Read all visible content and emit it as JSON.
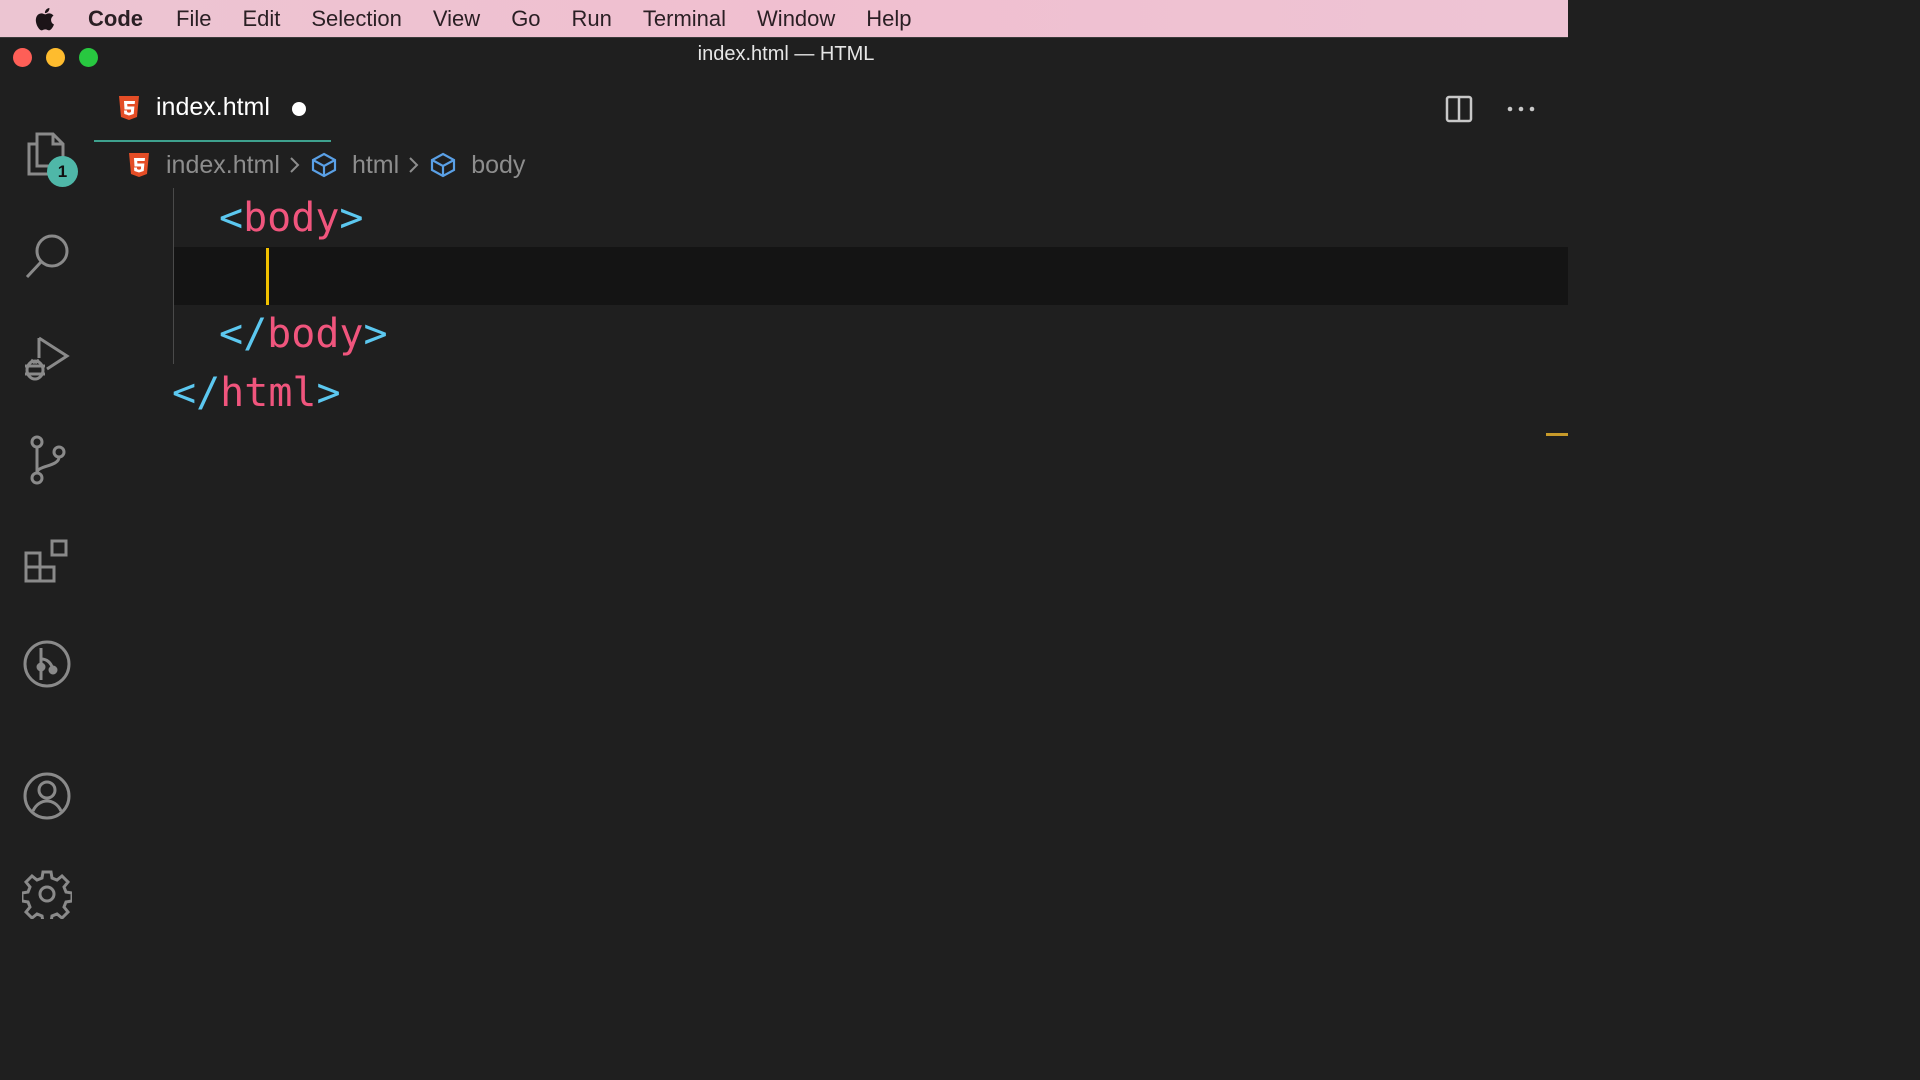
{
  "menubar": {
    "apple_icon": "apple-logo-icon",
    "items": [
      "Code",
      "File",
      "Edit",
      "Selection",
      "View",
      "Go",
      "Run",
      "Terminal",
      "Window",
      "Help"
    ]
  },
  "window": {
    "title": "index.html — HTML"
  },
  "activity_bar": {
    "icons": [
      "explorer-icon",
      "search-icon",
      "run-debug-icon",
      "source-control-icon",
      "extensions-icon",
      "git-graph-icon",
      "accounts-icon",
      "settings-gear-icon"
    ],
    "explorer_badge": "1"
  },
  "tabs": [
    {
      "label": "index.html",
      "icon": "html5-icon",
      "dirty": true
    }
  ],
  "breadcrumb": {
    "file": "index.html",
    "items": [
      "html",
      "body"
    ]
  },
  "editor": {
    "lines": [
      {
        "open": "<",
        "tag": "body",
        "close": ">"
      },
      {
        "open": "",
        "tag": "",
        "close": ""
      },
      {
        "open": "</",
        "tag": "body",
        "close": ">"
      },
      {
        "open": "</",
        "tag": "html",
        "close": ">"
      }
    ]
  },
  "colors": {
    "accent": "#3ea18e",
    "tag": "#f0557d",
    "punctuation": "#5cc8f0",
    "cursor": "#f0c000",
    "html5_icon": "#e44d26"
  }
}
